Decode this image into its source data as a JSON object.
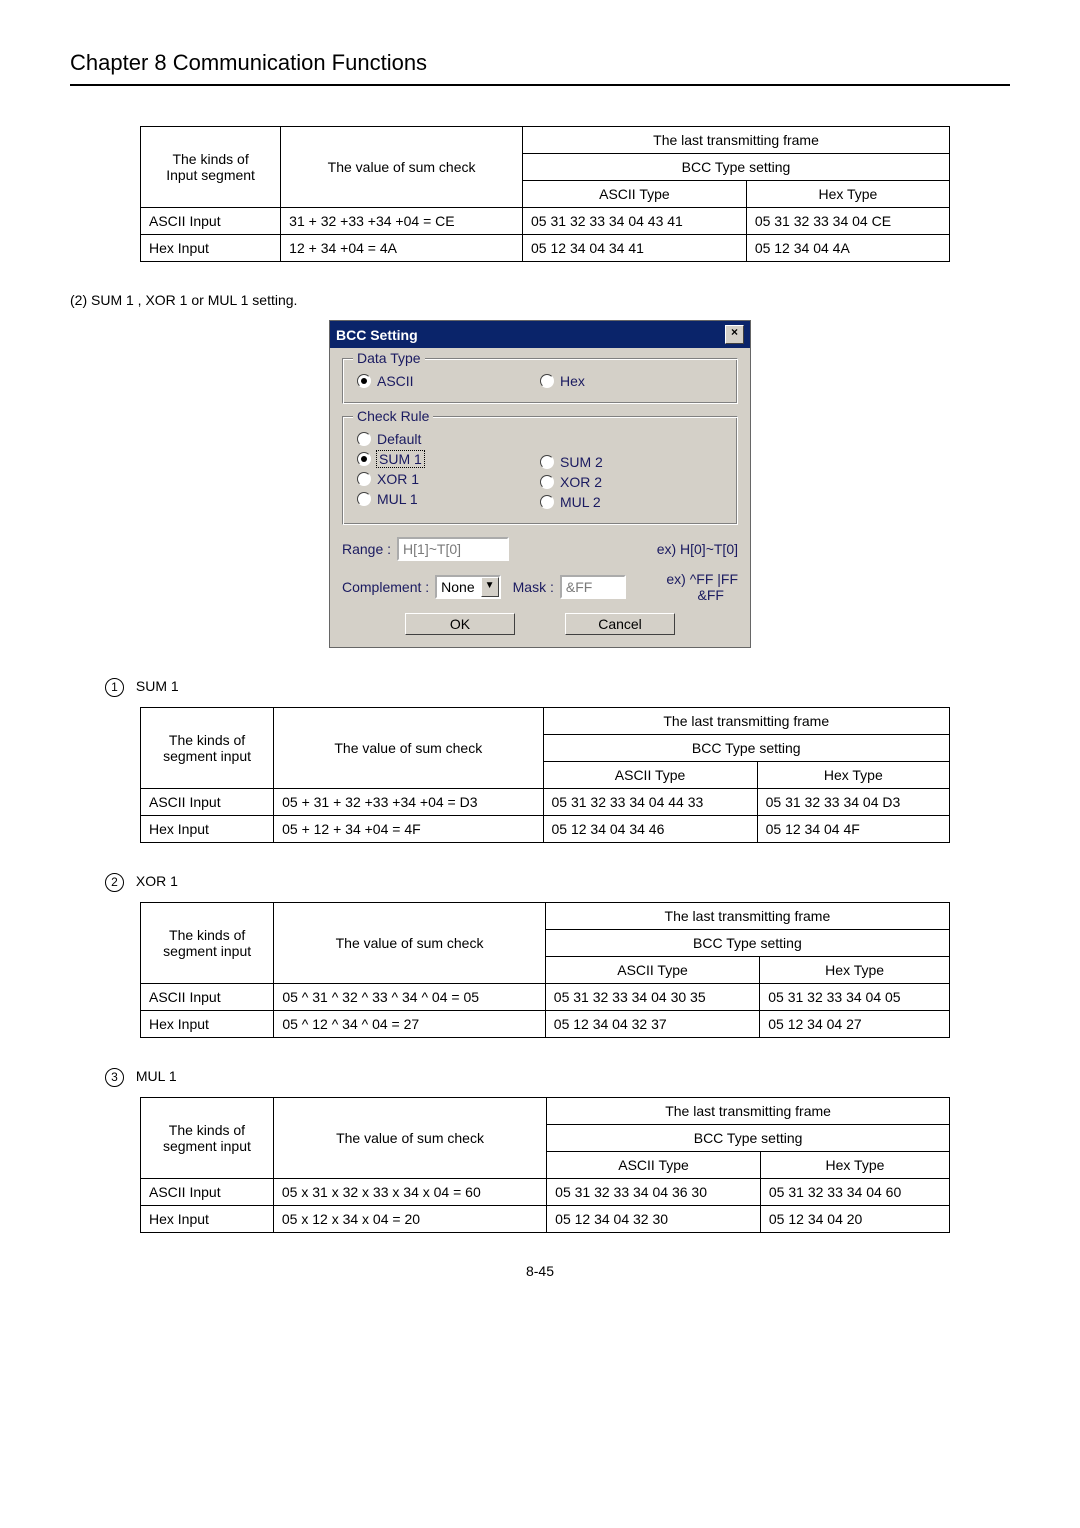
{
  "chapter_title": "Chapter 8    Communication Functions",
  "table_headers_common": {
    "last_frame": "The last transmitting frame",
    "sum_check": "The value of sum check",
    "ascii_type": "ASCII Type",
    "hex_type": "Hex Type"
  },
  "table0": {
    "kinds_label": "The kinds of\nInput segment",
    "bcc_label": "BCC Type setting",
    "rows": [
      {
        "kind": "ASCII Input",
        "sum": "31 + 32 +33 +34 +04 = CE",
        "ascii": "05 31 32 33 34 04 43 41",
        "hex": "05 31 32 33 34 04 CE"
      },
      {
        "kind": "Hex Input",
        "sum": "12 + 34 +04 = 4A",
        "ascii": "05 12 34 04 34 41",
        "hex": "05 12 34 04 4A"
      }
    ]
  },
  "caption2": "(2) SUM 1 , XOR 1 or MUL 1 setting.",
  "dialog": {
    "title": "BCC Setting",
    "group_data_type": "Data Type",
    "radio_ascii": "ASCII",
    "radio_hex": "Hex",
    "group_check_rule": "Check Rule",
    "radio_default": "Default",
    "radio_sum1": "SUM 1",
    "radio_xor1": "XOR 1",
    "radio_mul1": "MUL 1",
    "radio_sum2": "SUM 2",
    "radio_xor2": "XOR 2",
    "radio_mul2": "MUL 2",
    "range_label": "Range : ",
    "range_value": "H[1]~T[0]",
    "range_ex": "ex) H[0]~T[0]",
    "complement_label": "Complement : ",
    "complement_value": "None",
    "mask_label": "Mask : ",
    "mask_value": "&FF",
    "mask_ex": "ex) ^FF |FF\n        &FF",
    "ok": "OK",
    "cancel": "Cancel"
  },
  "sec_sum1": "SUM 1",
  "sec_xor1": "XOR 1",
  "sec_mul1": "MUL 1",
  "table1": {
    "kinds_label": "The kinds of\nsegment input",
    "bcc_label": "BCC    Type setting",
    "rows": [
      {
        "kind": "ASCII Input",
        "sum": "05 + 31 + 32 +33 +34 +04 = D3",
        "ascii": "05 31 32 33 34 04 44 33",
        "hex": "05 31 32 33 34 04 D3"
      },
      {
        "kind": "Hex Input",
        "sum": "05 + 12 + 34 +04 = 4F",
        "ascii": "05 12 34 04 34 46",
        "hex": "05 12 34 04 4F"
      }
    ]
  },
  "table2": {
    "kinds_label": "The kinds of\nsegment input",
    "bcc_label": "BCC    Type setting",
    "rows": [
      {
        "kind": "ASCII Input",
        "sum": "05 ^ 31 ^ 32 ^ 33 ^ 34 ^ 04 = 05",
        "ascii": "05 31 32 33 34 04 30 35",
        "hex": "05 31 32 33 34 04 05"
      },
      {
        "kind": "Hex Input",
        "sum": "05 ^ 12 ^ 34 ^ 04 = 27",
        "ascii": "05 12 34 04 32 37",
        "hex": "05 12 34 04 27"
      }
    ]
  },
  "table3": {
    "kinds_label": "The kinds of\nsegment input",
    "bcc_label": "BCC    Type setting",
    "rows": [
      {
        "kind": "ASCII Input",
        "sum": "05 x 31 x 32 x 33 x 34 x 04 = 60",
        "ascii": "05 31 32 33 34 04 36 30",
        "hex": "05 31 32 33 34 04 60"
      },
      {
        "kind": "Hex Input",
        "sum": "05 x 12 x 34 x 04 = 20",
        "ascii": "05 12 34 04 32 30",
        "hex": "05 12 34 04 20"
      }
    ]
  },
  "page_number": "8-45"
}
